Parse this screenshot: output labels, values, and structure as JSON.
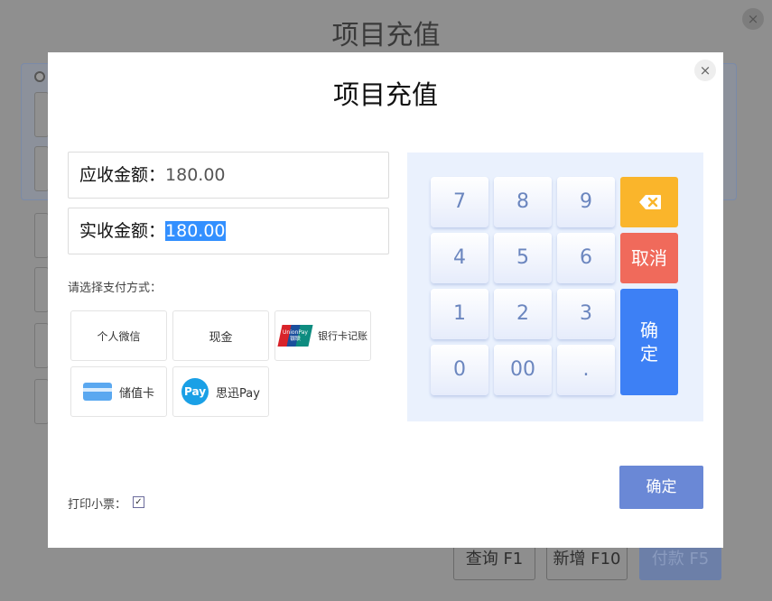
{
  "background": {
    "title": "项目充值",
    "close_icon": "×",
    "buttons": {
      "query": "查询 F1",
      "add": "新增 F10",
      "pay": "付款 F5"
    }
  },
  "modal": {
    "title": "项目充值",
    "close_icon": "×",
    "receivable": {
      "label": "应收金额：",
      "value": "180.00"
    },
    "received": {
      "label": "实收金额：",
      "value": "180.00"
    },
    "payment_label": "请选择支付方式：",
    "payment_methods": [
      {
        "label": "个人微信",
        "icon": "none"
      },
      {
        "label": "现金",
        "icon": "none"
      },
      {
        "label": "银行卡记账",
        "icon": "unionpay-icon",
        "icon_text": "UnionPay 银联"
      },
      {
        "label": "储值卡",
        "icon": "card-icon"
      },
      {
        "label": "思迅Pay",
        "icon": "pay-icon",
        "icon_text": "Pay"
      }
    ],
    "keypad": {
      "keys": [
        "7",
        "8",
        "9",
        "4",
        "5",
        "6",
        "1",
        "2",
        "3",
        "0",
        "00",
        "."
      ],
      "backspace_icon": "backspace-icon",
      "cancel": "取消",
      "confirm": "确定"
    },
    "confirm_button": "确定",
    "print_receipt": {
      "label": "打印小票：",
      "checked": true,
      "check_mark": "✓"
    }
  },
  "colors": {
    "keypad_bg": "#eaf1fd",
    "key_text": "#6b86bf",
    "backspace": "#fab52b",
    "cancel": "#f06a5b",
    "confirm": "#3d80f5",
    "confirm_button": "#6a88d6",
    "selection": "#3390ff"
  }
}
